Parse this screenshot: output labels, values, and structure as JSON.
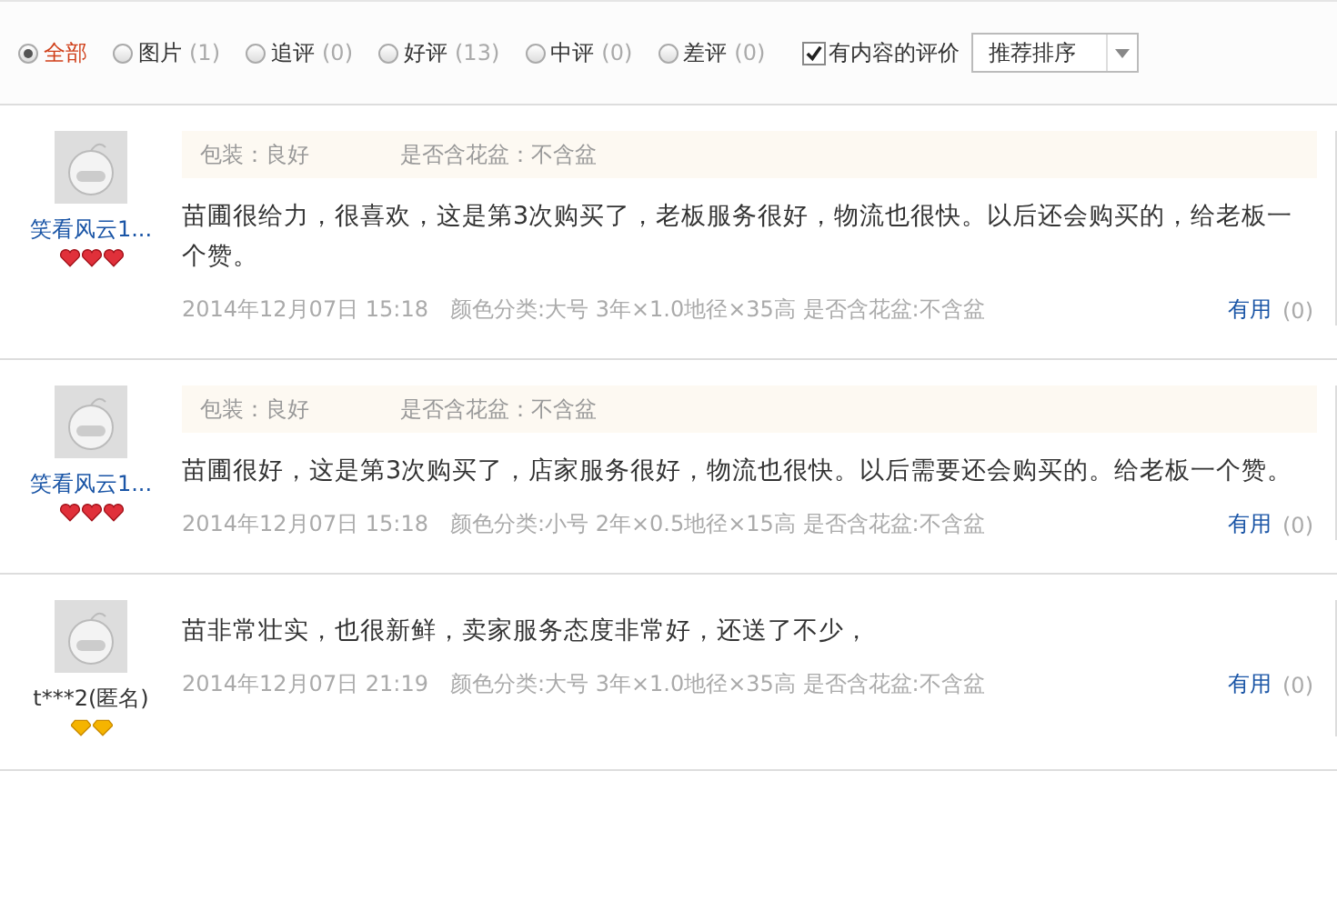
{
  "filters": [
    {
      "label": "全部",
      "selected": true
    },
    {
      "label": "图片",
      "count": "(1)",
      "selected": false
    },
    {
      "label": "追评",
      "count": "(0)",
      "selected": false
    },
    {
      "label": "好评",
      "count": "(13)",
      "selected": false
    },
    {
      "label": "中评",
      "count": "(0)",
      "selected": false
    },
    {
      "label": "差评",
      "count": "(0)",
      "selected": false
    }
  ],
  "content_only": {
    "label": "有内容的评价",
    "checked": true
  },
  "sort": {
    "value": "推荐排序"
  },
  "reviews": [
    {
      "user": "笑看风云1...",
      "badges": [
        {
          "kind": "heart"
        },
        {
          "kind": "heart"
        },
        {
          "kind": "heart"
        }
      ],
      "tags": [
        "包装：良好",
        "是否含花盆：不含盆"
      ],
      "text": "苗圃很给力，很喜欢，这是第3次购买了，老板服务很好，物流也很快。以后还会购买的，给老板一个赞。",
      "date": "2014年12月07日 15:18",
      "spec": "颜色分类:大号 3年×1.0地径×35高  是否含花盆:不含盆",
      "helpful": "有用",
      "helpful_count": "(0)"
    },
    {
      "user": "笑看风云1...",
      "badges": [
        {
          "kind": "heart"
        },
        {
          "kind": "heart"
        },
        {
          "kind": "heart"
        }
      ],
      "tags": [
        "包装：良好",
        "是否含花盆：不含盆"
      ],
      "text": "苗圃很好，这是第3次购买了，店家服务很好，物流也很快。以后需要还会购买的。给老板一个赞。",
      "date": "2014年12月07日 15:18",
      "spec": "颜色分类:小号 2年×0.5地径×15高  是否含花盆:不含盆",
      "helpful": "有用",
      "helpful_count": "(0)"
    },
    {
      "user": "t***2(匿名)",
      "badges": [
        {
          "kind": "diamond"
        },
        {
          "kind": "diamond"
        }
      ],
      "text": "苗非常壮实，也很新鲜，卖家服务态度非常好，还送了不少，",
      "date": "2014年12月07日 21:19",
      "spec": "颜色分类:大号 3年×1.0地径×35高  是否含花盆:不含盆",
      "helpful": "有用",
      "helpful_count": "(0)"
    }
  ]
}
